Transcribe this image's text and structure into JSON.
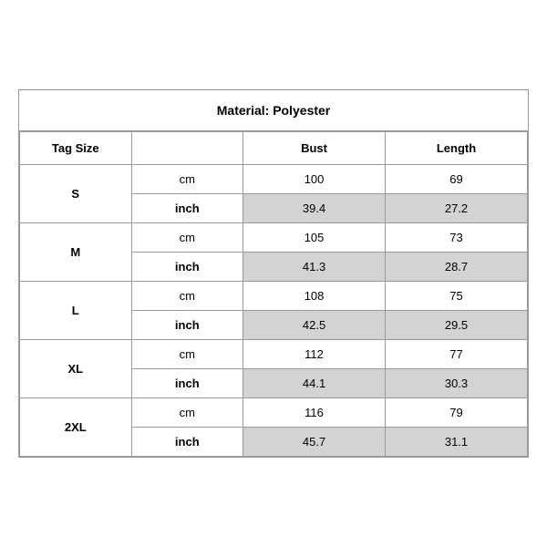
{
  "title": "Material: Polyester",
  "headers": {
    "tag_size": "Tag Size",
    "bust": "Bust",
    "length": "Length"
  },
  "rows": [
    {
      "size": "S",
      "cm": {
        "bust": "100",
        "length": "69"
      },
      "inch": {
        "bust": "39.4",
        "length": "27.2"
      }
    },
    {
      "size": "M",
      "cm": {
        "bust": "105",
        "length": "73"
      },
      "inch": {
        "bust": "41.3",
        "length": "28.7"
      }
    },
    {
      "size": "L",
      "cm": {
        "bust": "108",
        "length": "75"
      },
      "inch": {
        "bust": "42.5",
        "length": "29.5"
      }
    },
    {
      "size": "XL",
      "cm": {
        "bust": "112",
        "length": "77"
      },
      "inch": {
        "bust": "44.1",
        "length": "30.3"
      }
    },
    {
      "size": "2XL",
      "cm": {
        "bust": "116",
        "length": "79"
      },
      "inch": {
        "bust": "45.7",
        "length": "31.1"
      }
    }
  ],
  "unit_cm": "cm",
  "unit_inch": "inch"
}
